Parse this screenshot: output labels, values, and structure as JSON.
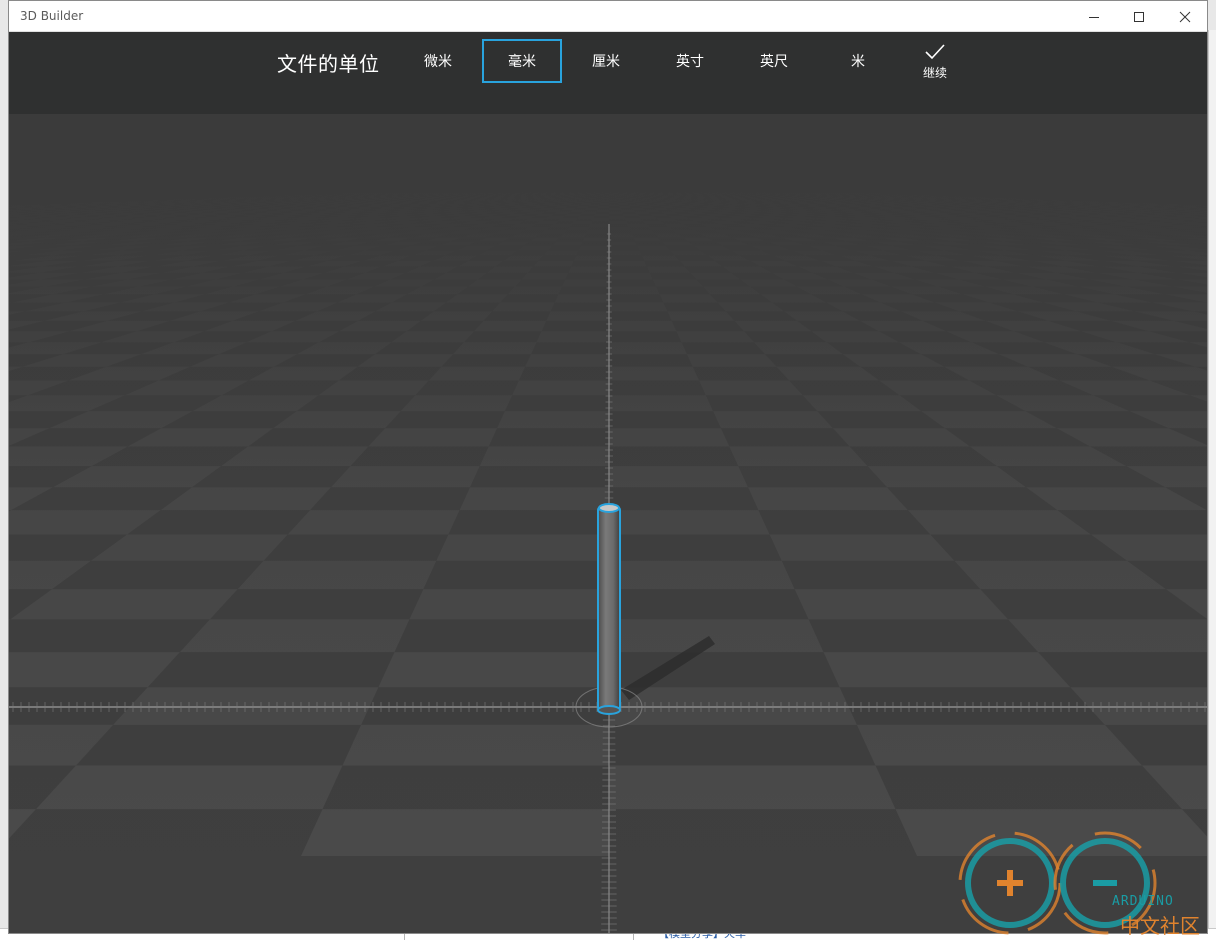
{
  "window": {
    "title": "3D Builder"
  },
  "toolbar": {
    "heading": "文件的单位",
    "units": [
      {
        "label": "微米",
        "selected": false
      },
      {
        "label": "毫米",
        "selected": true
      },
      {
        "label": "厘米",
        "selected": false
      },
      {
        "label": "英寸",
        "selected": false
      },
      {
        "label": "英尺",
        "selected": false
      },
      {
        "label": "米",
        "selected": false
      }
    ],
    "continue_label": "继续",
    "continue_icon": "checkmark-icon"
  },
  "background": {
    "bottom_link_text": "【模型分享】火车"
  },
  "watermark": {
    "brand": "ARDUINO",
    "subtitle": "中文社区"
  },
  "colors": {
    "accent": "#29a3dd",
    "toolbar_bg": "#2f3030",
    "viewport_bg": "#3c3c3c",
    "watermark_teal": "#1a9ca4",
    "watermark_orange": "#e0832e"
  }
}
